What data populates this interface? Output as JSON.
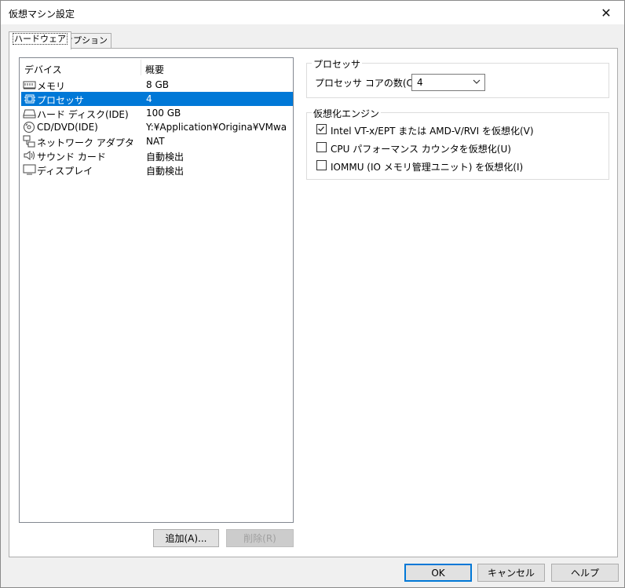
{
  "window": {
    "title": "仮想マシン設定",
    "close_glyph": "✕"
  },
  "tabs": [
    {
      "label": "ハードウェア",
      "active": true
    },
    {
      "label": "オプション",
      "active": false
    }
  ],
  "device_list": {
    "headers": {
      "device": "デバイス",
      "summary": "概要"
    },
    "rows": [
      {
        "icon": "memory-icon",
        "name": "メモリ",
        "summary": "8 GB",
        "selected": false
      },
      {
        "icon": "processor-icon",
        "name": "プロセッサ",
        "summary": "4",
        "selected": true
      },
      {
        "icon": "hard-disk-icon",
        "name": "ハード ディスク(IDE)",
        "summary": "100 GB",
        "selected": false
      },
      {
        "icon": "cd-dvd-icon",
        "name": "CD/DVD(IDE)",
        "summary": "Y:¥Application¥Origina¥VMwar...",
        "selected": false
      },
      {
        "icon": "network-adapter-icon",
        "name": "ネットワーク アダプタ",
        "summary": "NAT",
        "selected": false
      },
      {
        "icon": "sound-card-icon",
        "name": "サウンド カード",
        "summary": "自動検出",
        "selected": false
      },
      {
        "icon": "display-icon",
        "name": "ディスプレイ",
        "summary": "自動検出",
        "selected": false
      }
    ]
  },
  "list_buttons": {
    "add": "追加(A)...",
    "remove": "削除(R)"
  },
  "processor": {
    "group_title": "プロセッサ",
    "cores_label": "プロセッサ コアの数(C):",
    "cores_value": "4"
  },
  "virtualization": {
    "group_title": "仮想化エンジン",
    "options": [
      {
        "label": "Intel VT-x/EPT または AMD-V/RVI を仮想化(V)",
        "checked": true
      },
      {
        "label": "CPU パフォーマンス カウンタを仮想化(U)",
        "checked": false
      },
      {
        "label": "IOMMU (IO メモリ管理ユニット) を仮想化(I)",
        "checked": false
      }
    ]
  },
  "footer_buttons": {
    "ok": "OK",
    "cancel": "キャンセル",
    "help": "ヘルプ"
  },
  "colors": {
    "selection": "#0078d7",
    "window_bg": "#f0f0f0",
    "page_bg": "#ffffff"
  }
}
